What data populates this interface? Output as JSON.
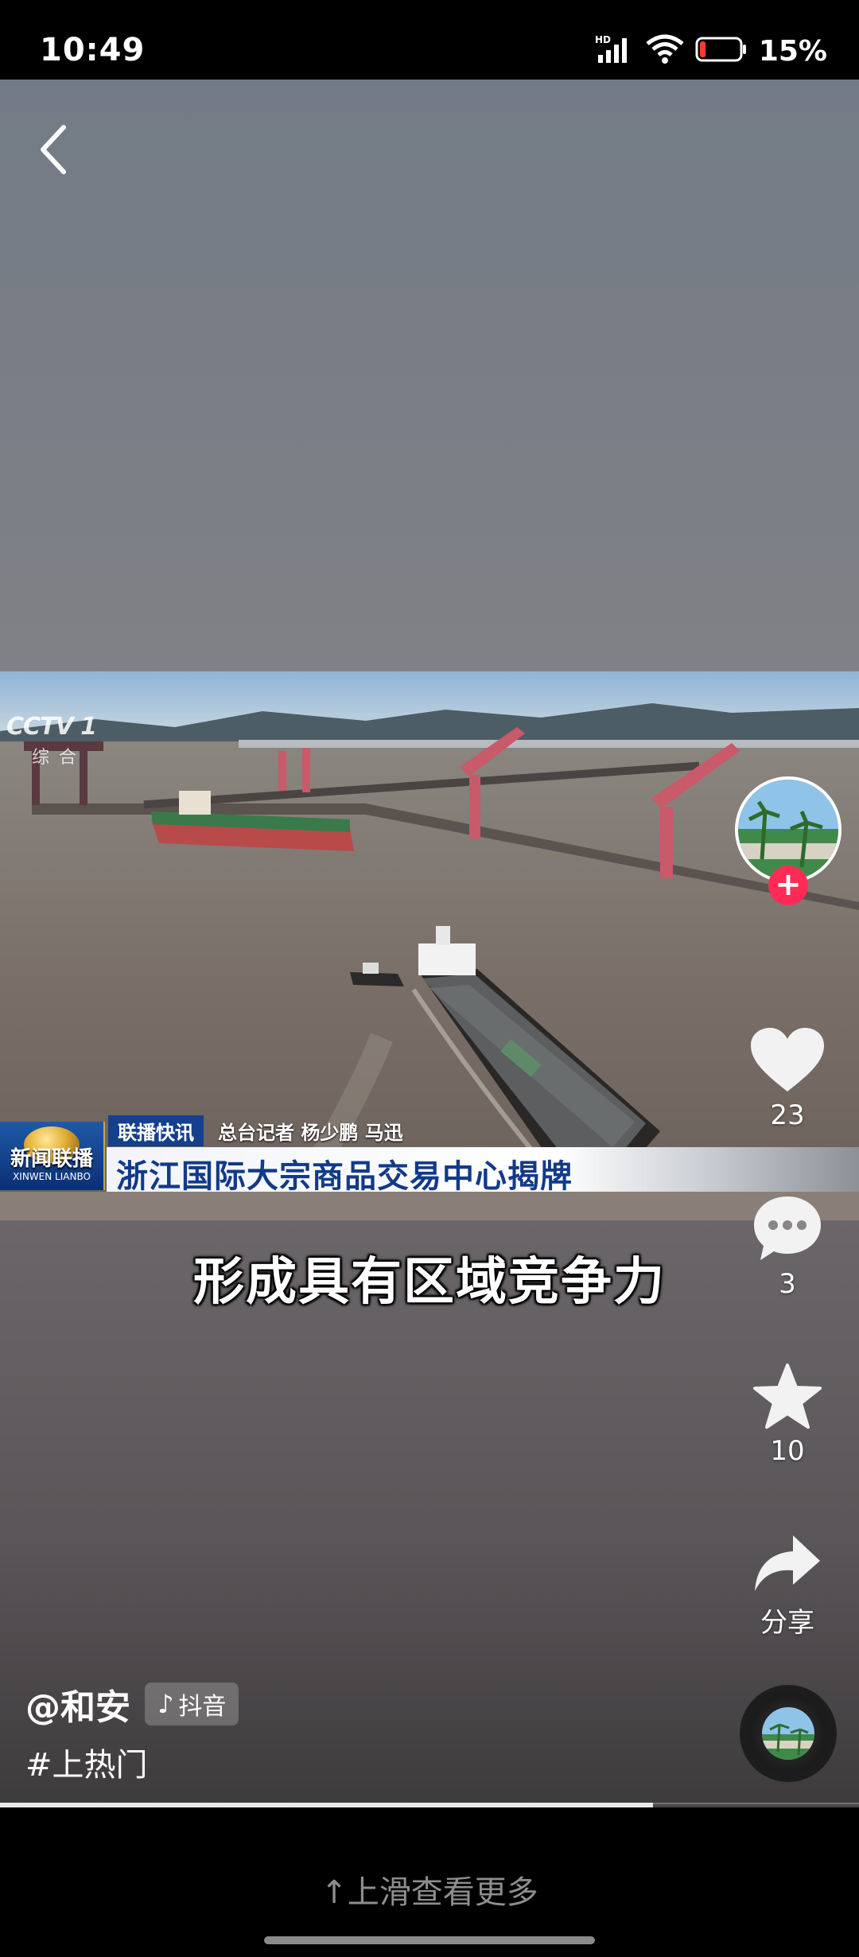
{
  "status_bar": {
    "time": "10:49",
    "network_label": "HD",
    "battery_percent": "15%",
    "battery_level": 0.15,
    "icons": [
      "signal-icon",
      "wifi-icon",
      "battery-icon"
    ]
  },
  "video": {
    "channel_logo": "CCTV 1",
    "channel_sub": "综合",
    "news_program": "新闻联播",
    "news_program_en": "XINWEN LIANBO",
    "lower_third_tag": "联播快讯",
    "reporters": "总台记者 杨少鹏 马迅",
    "headline": "浙江国际大宗商品交易中心揭牌",
    "subtitle": "形成具有区域竞争力",
    "progress": 0.76
  },
  "actions": {
    "likes": "23",
    "comments": "3",
    "favorites": "10",
    "share_label": "分享"
  },
  "post": {
    "author": "@和安",
    "platform_badge": "抖音",
    "hashtag": "#上热门"
  },
  "footer": {
    "swipe_hint": "上滑查看更多"
  },
  "colors": {
    "follow_red": "#fe2c55",
    "headline_blue": "#123a88",
    "tag_blue": "#14408c"
  }
}
